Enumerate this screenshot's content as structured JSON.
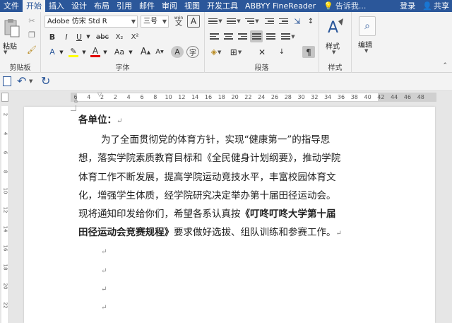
{
  "tabs": [
    {
      "label": "文件",
      "active": false
    },
    {
      "label": "开始",
      "active": true
    },
    {
      "label": "插入",
      "active": false
    },
    {
      "label": "设计",
      "active": false
    },
    {
      "label": "布局",
      "active": false
    },
    {
      "label": "引用",
      "active": false
    },
    {
      "label": "邮件",
      "active": false
    },
    {
      "label": "审阅",
      "active": false
    },
    {
      "label": "视图",
      "active": false
    },
    {
      "label": "开发工具",
      "active": false
    },
    {
      "label": "ABBYY FineReader",
      "active": false
    }
  ],
  "tell_me": "告诉我...",
  "login": "登录",
  "share": "共享",
  "ribbon": {
    "clipboard": {
      "paste_label": "粘贴",
      "group_label": "剪贴板"
    },
    "font": {
      "font_name": "Adobe 仿宋 Std R",
      "font_size": "三号",
      "wen_label": "wén",
      "group_label": "字体",
      "bold": "B",
      "italic": "I",
      "underline": "U",
      "strike": "abc",
      "subscript": "X₂",
      "superscript": "X²",
      "grow": "A",
      "shrink": "A",
      "case": "Aa",
      "clear": "A",
      "effects": "A",
      "font_color": "A",
      "char_shade": "A",
      "enclose": "字",
      "border_char": "A"
    },
    "paragraph": {
      "group_label": "段落"
    },
    "styles": {
      "label": "样式",
      "group_label": "样式"
    },
    "editing": {
      "label": "编辑"
    }
  },
  "ruler": {
    "ticks": [
      "6",
      "4",
      "2",
      "2",
      "4",
      "6",
      "8",
      "10",
      "12",
      "14",
      "16",
      "18",
      "20",
      "22",
      "24",
      "26",
      "28",
      "30",
      "32",
      "34",
      "36",
      "38",
      "40",
      "42",
      "44",
      "46",
      "48"
    ],
    "vticks": [
      "2",
      "4",
      "6",
      "8",
      "10",
      "12",
      "14",
      "16",
      "18",
      "20",
      "22"
    ]
  },
  "document": {
    "salutation": "各单位：",
    "para_mark": "↵",
    "lines": [
      "为了全面贯彻党的体育方针，实现“健康第一”的指导思",
      "想，落实学院素质教育目标和《全民健身计划纲要》，推动学院",
      "体育工作不断发展，提高学院运动竞技水平，丰富校园体育文",
      "化，增强学生体质，经学院研究决定举办第十届田径运动会。",
      "现将通知印发给你们，希望各系认真按"
    ],
    "bold_title_part1": "《叮咚叮咚大学第十届",
    "bold_title_part2": "田径运动会竞赛规程》",
    "tail": "要求做好选拔、组队训练和参赛工作。"
  }
}
